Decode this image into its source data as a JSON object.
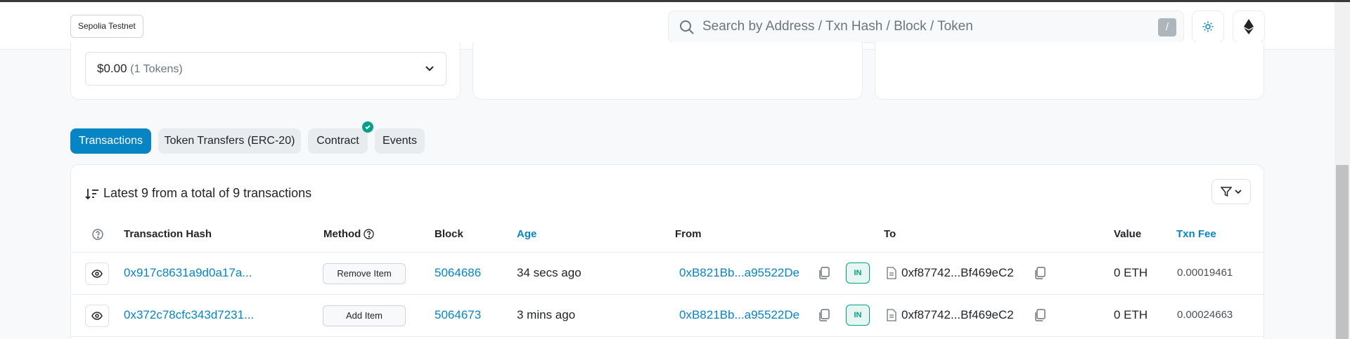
{
  "header": {
    "network_badge": "Sepolia Testnet",
    "search_placeholder": "Search by Address / Txn Hash / Block / Token",
    "search_shortcut": "/",
    "theme_icon": "sun-icon",
    "network_icon": "ethereum-icon"
  },
  "overview": {
    "balance_value": "$0.00",
    "balance_tokens": "(1 Tokens)"
  },
  "tabs": [
    {
      "label": "Transactions",
      "active": true
    },
    {
      "label": "Token Transfers (ERC-20)",
      "active": false
    },
    {
      "label": "Contract",
      "active": false,
      "verified": true
    },
    {
      "label": "Events",
      "active": false
    }
  ],
  "transactions": {
    "summary": "Latest 9 from a total of 9 transactions",
    "columns": {
      "hash": "Transaction Hash",
      "method": "Method",
      "block": "Block",
      "age": "Age",
      "from": "From",
      "to": "To",
      "value": "Value",
      "fee": "Txn Fee"
    },
    "rows": [
      {
        "hash": "0x917c8631a9d0a17a...",
        "method": "Remove Item",
        "block": "5064686",
        "age": "34 secs ago",
        "from": "0xB821Bb...a95522De",
        "direction": "IN",
        "to": "0xf87742...Bf469eC2",
        "value": "0 ETH",
        "fee": "0.00019461"
      },
      {
        "hash": "0x372c78cfc343d7231...",
        "method": "Add Item",
        "block": "5064673",
        "age": "3 mins ago",
        "from": "0xB821Bb...a95522De",
        "direction": "IN",
        "to": "0xf87742...Bf469eC2",
        "value": "0 ETH",
        "fee": "0.00024663"
      }
    ]
  },
  "colors": {
    "accent": "#0784c3",
    "success": "#00a186"
  }
}
